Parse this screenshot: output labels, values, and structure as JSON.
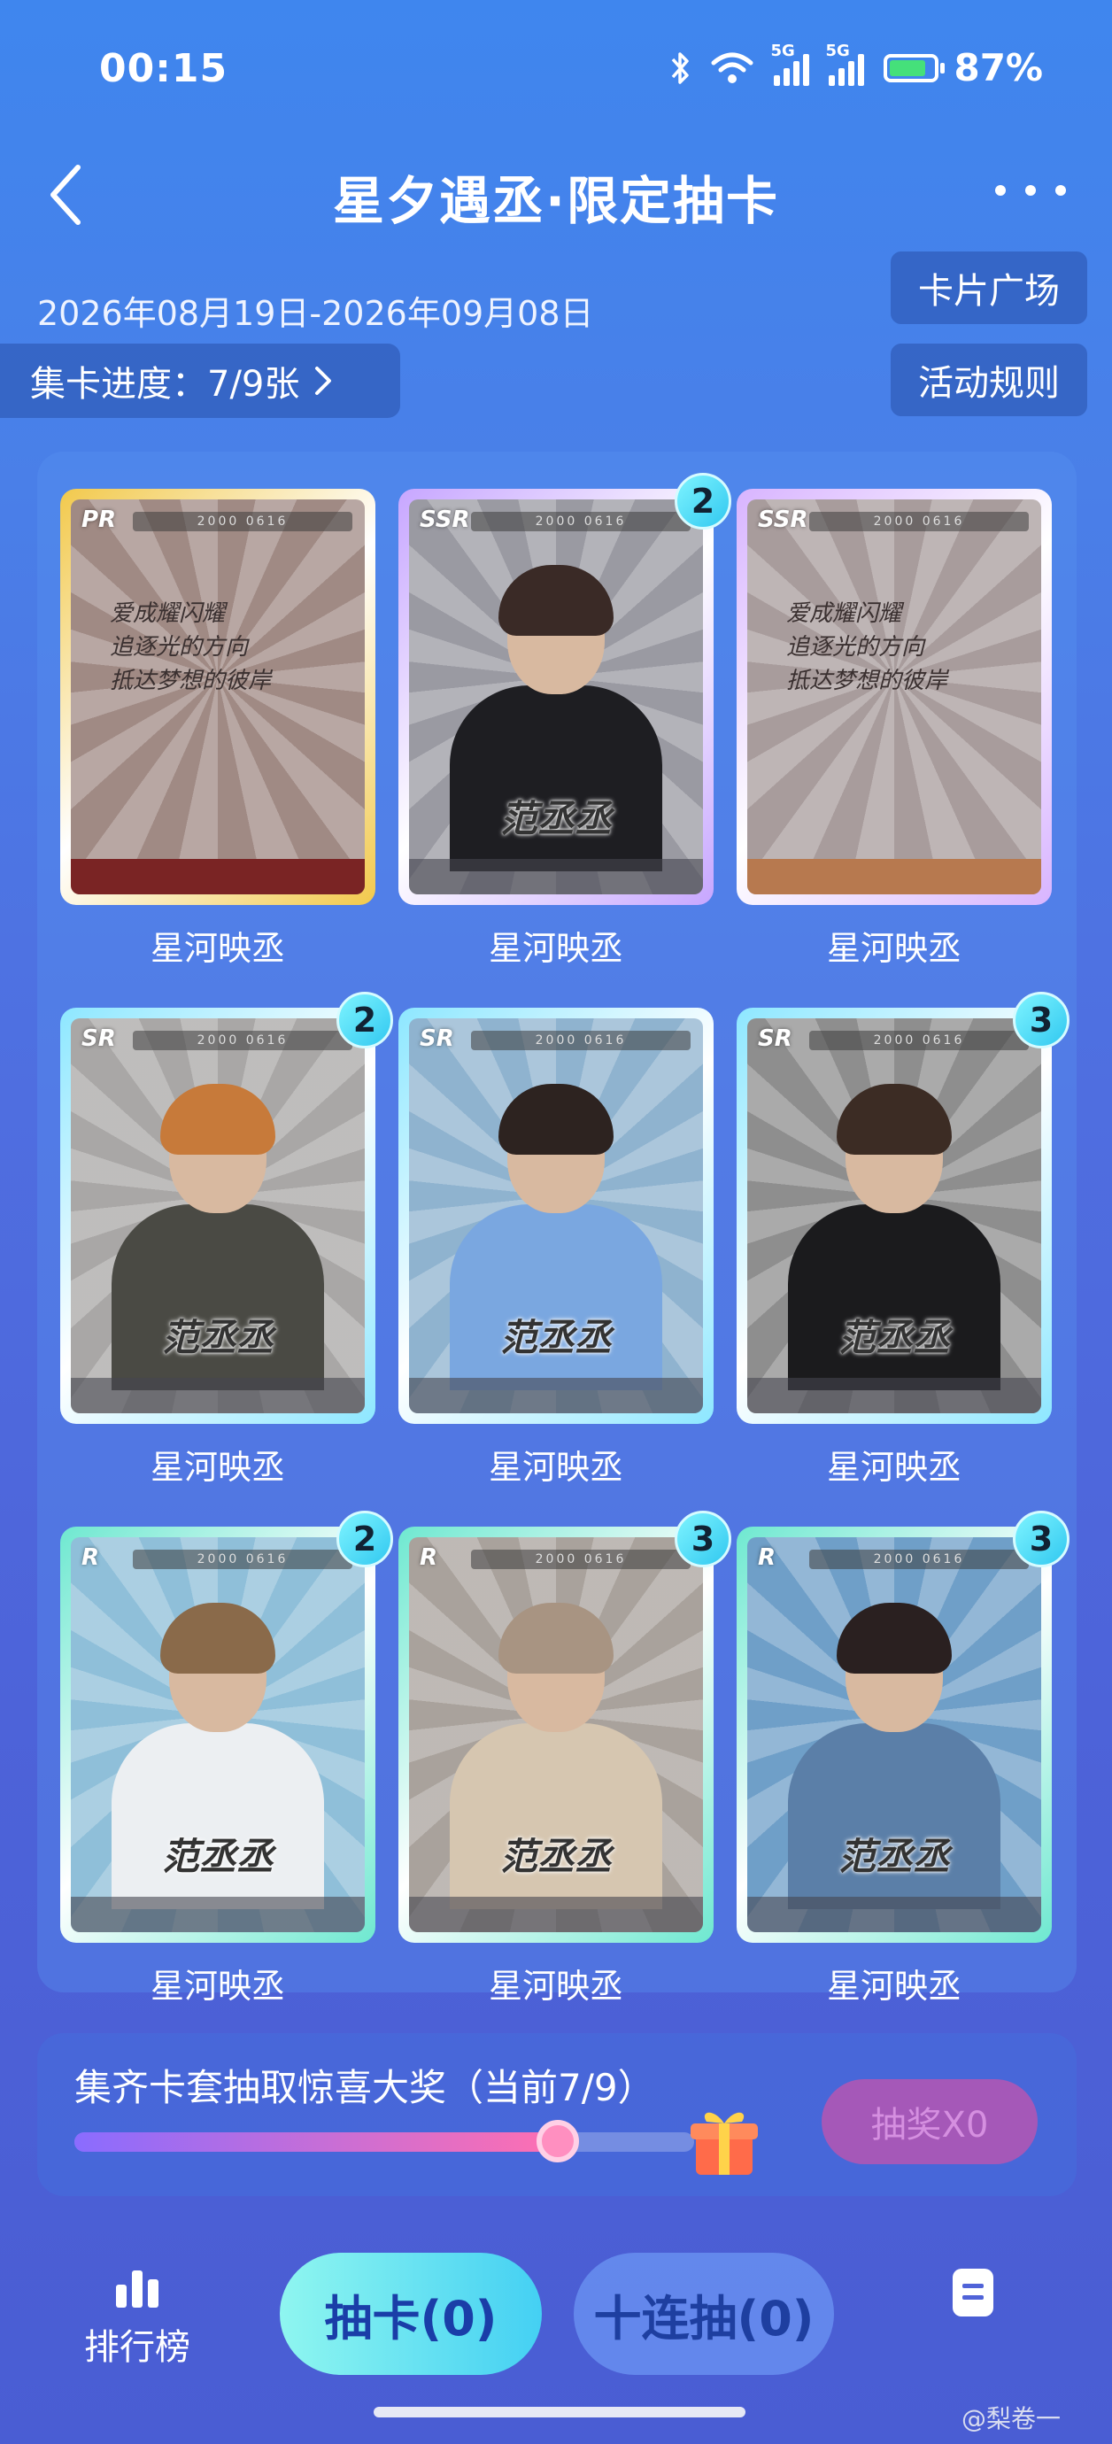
{
  "status": {
    "time": "00:15",
    "network1": "5G",
    "network2": "5G",
    "battery": "87%"
  },
  "header": {
    "title": "星夕遇丞·限定抽卡"
  },
  "event": {
    "date_range": "2026年08月19日-2026年09月08日",
    "progress_label": "集卡进度：7/9张",
    "card_square": "卡片广场",
    "rules": "活动规则"
  },
  "cards": [
    {
      "rarity": "PR",
      "count": "",
      "name": "星河映丞",
      "serial": "2000 0616",
      "logo": "",
      "sign": "爱成耀闪耀\n追逐光的方向\n抵达梦想的彼岸",
      "style": "sign",
      "frame": "#f2c94c",
      "bg": "#a08a84",
      "footer": "#7a2424"
    },
    {
      "rarity": "SSR",
      "count": "2",
      "name": "星河映丞",
      "serial": "2000 0616",
      "logo": "范丞丞",
      "sign": "",
      "style": "photo",
      "frame": "#c7a6ff",
      "bg": "#9a9aa2",
      "hair": "#3a2a26",
      "body": "#1e1e22"
    },
    {
      "rarity": "SSR",
      "count": "",
      "name": "星河映丞",
      "serial": "2000 0616",
      "logo": "",
      "sign": "爱成耀闪耀\n追逐光的方向\n抵达梦想的彼岸",
      "style": "sign",
      "frame": "#d8b4ff",
      "bg": "#a89c9c",
      "footer": "#b7794f"
    },
    {
      "rarity": "SR",
      "count": "2",
      "name": "星河映丞",
      "serial": "2000 0616",
      "logo": "范丞丞",
      "sign": "",
      "style": "photo",
      "frame": "#8de7ff",
      "bg": "#a9a7a6",
      "hair": "#c77a3a",
      "body": "#4a4a44"
    },
    {
      "rarity": "SR",
      "count": "",
      "name": "星河映丞",
      "serial": "2000 0616",
      "logo": "范丞丞",
      "sign": "",
      "style": "photo",
      "frame": "#8de7ff",
      "bg": "#8fb3cf",
      "hair": "#2d2320",
      "body": "#7aa7e0"
    },
    {
      "rarity": "SR",
      "count": "3",
      "name": "星河映丞",
      "serial": "2000 0616",
      "logo": "范丞丞",
      "sign": "",
      "style": "photo",
      "frame": "#8de7ff",
      "bg": "#8e8e8e",
      "hair": "#3c2c24",
      "body": "#1b1b1d"
    },
    {
      "rarity": "R",
      "count": "2",
      "name": "星河映丞",
      "serial": "2000 0616",
      "logo": "范丞丞",
      "sign": "",
      "style": "photo",
      "frame": "#6ee8d0",
      "bg": "#8fbfd9",
      "hair": "#8a6a4a",
      "body": "#eceff2"
    },
    {
      "rarity": "R",
      "count": "3",
      "name": "星河映丞",
      "serial": "2000 0616",
      "logo": "范丞丞",
      "sign": "",
      "style": "photo",
      "frame": "#6ee8d0",
      "bg": "#a9a29c",
      "hair": "#a89482",
      "body": "#d6c6b0"
    },
    {
      "rarity": "R",
      "count": "3",
      "name": "星河映丞",
      "serial": "2000 0616",
      "logo": "范丞丞",
      "sign": "",
      "style": "photo",
      "frame": "#6ee8d0",
      "bg": "#6f9fc8",
      "hair": "#2a2020",
      "body": "#5b7fa8"
    }
  ],
  "reward": {
    "text": "集齐卡套抽取惊喜大奖（当前7/9）",
    "progress": 0.78,
    "button": "抽奖X0"
  },
  "bottom": {
    "rank_label": "排行榜",
    "draw_label": "抽卡(0)",
    "ten_draw_label": "十连抽(0)"
  },
  "watermark": "@梨卷一"
}
